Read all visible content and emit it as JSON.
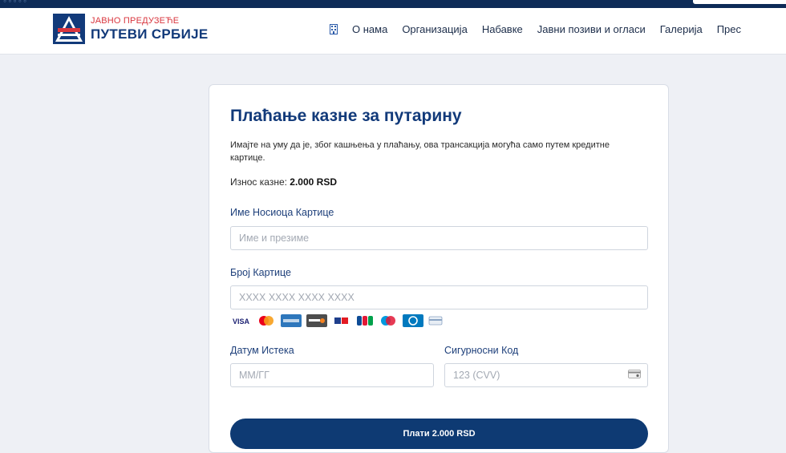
{
  "colors": {
    "top_strip": "#0d2b57",
    "brand_blue": "#123a7a",
    "brand_red": "#d9363e",
    "button": "#0e3a73",
    "page_bg": "#eef0f5"
  },
  "header": {
    "logo_small": "ЈАВНО ПРЕДУЗЕЋЕ",
    "logo_big": "ПУТЕВИ СРБИЈЕ",
    "nav": [
      "О нама",
      "Организација",
      "Набавке",
      "Јавни позиви и огласи",
      "Галерија",
      "Прес"
    ]
  },
  "form": {
    "title": "Плаћање казне за путарину",
    "notice": "Имајте на уму да је, због кашњења у плаћању, ова трансакција могућа само путем кредитне картице.",
    "amount_label": "Износ казне:",
    "amount_value": "2.000 RSD",
    "cardholder_label": "Име Носиоца Картице",
    "cardholder_placeholder": "Име и презиме",
    "card_number_label": "Број Картице",
    "card_number_placeholder": "XXXX XXXX XXXX XXXX",
    "card_brands": [
      "visa",
      "mastercard",
      "amex",
      "discover",
      "maestro",
      "jcb",
      "maestro-alt",
      "diners",
      "generic"
    ],
    "expiry_label": "Датум Истека",
    "expiry_placeholder": "ММ/ГГ",
    "cvv_label": "Сигурносни Код",
    "cvv_placeholder": "123 (CVV)",
    "pay_button": "Плати 2.000 RSD"
  }
}
